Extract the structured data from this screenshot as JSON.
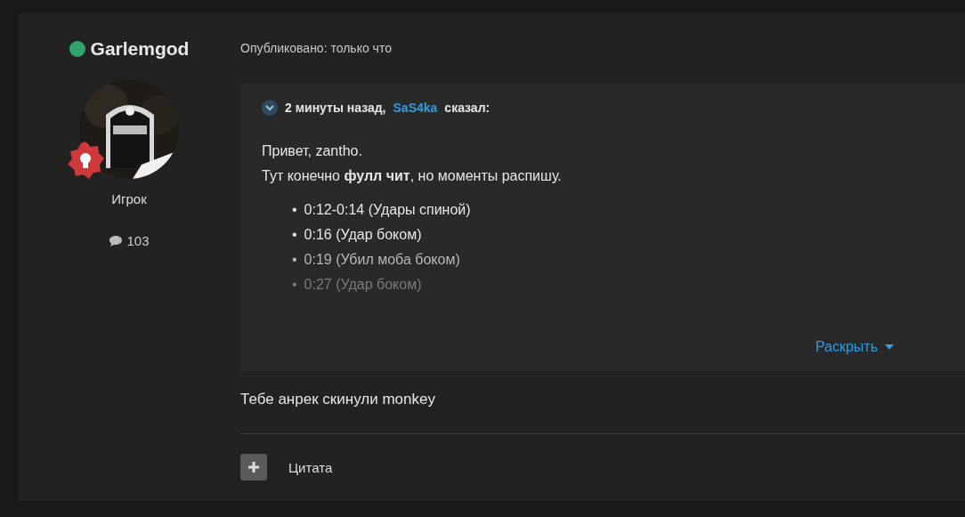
{
  "author": {
    "name": "Garlemgod",
    "online": true,
    "rank": "Игрок",
    "posts": "103"
  },
  "post": {
    "published": "Опубликовано: только что",
    "quote": {
      "time": "2 минуты назад,",
      "user": "SaS4ka",
      "said": "сказал:",
      "paragraphs": [
        "Привет, zantho.",
        "Тут конечно **фулл чит**, но моменты распишу."
      ],
      "bullet": "•",
      "items": [
        "0:12-0:14 (Удары спиной)",
        "0:16 (Удар боком)",
        "0:19 (Убил моба боком)",
        "0:27 (Удар боком)"
      ],
      "expand": "Раскрыть"
    },
    "text": "Тебе анрек скинули monkey",
    "actions": [
      {
        "label": "Цитата"
      }
    ]
  }
}
